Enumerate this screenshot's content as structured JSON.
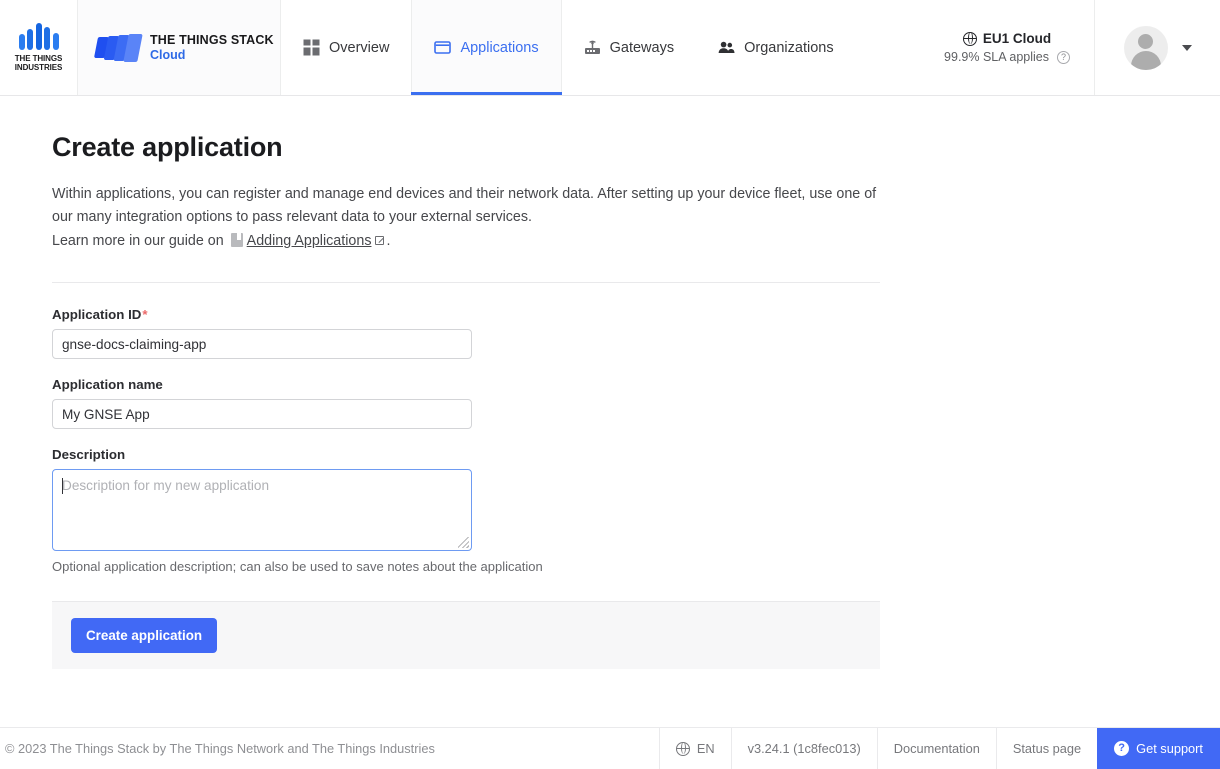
{
  "header": {
    "brand_logo_text": "THE THINGS\nINDUSTRIES",
    "brand_line1": "THE THINGS",
    "brand_line2": "INDUSTRIES",
    "stack_title": "THE THINGS STACK",
    "stack_sub": "Cloud",
    "nav": [
      {
        "label": "Overview",
        "icon": "grid-icon",
        "active": false
      },
      {
        "label": "Applications",
        "icon": "application-icon",
        "active": true
      },
      {
        "label": "Gateways",
        "icon": "gateway-icon",
        "active": false
      },
      {
        "label": "Organizations",
        "icon": "organizations-icon",
        "active": false
      }
    ],
    "cloud": {
      "name": "EU1 Cloud",
      "sla": "99.9% SLA applies",
      "help_glyph": "?",
      "globe_icon": "globe-icon"
    },
    "avatar_icon": "user-avatar",
    "caret_icon": "chevron-down-icon"
  },
  "main": {
    "title": "Create application",
    "intro": "Within applications, you can register and manage end devices and their network data. After setting up your device fleet, use one of our many integration options to pass relevant data to your external services.",
    "guide_prefix": "Learn more in our guide on",
    "guide_link": "Adding Applications",
    "guide_suffix": ".",
    "book_icon": "book-icon",
    "external_icon": "external-link-icon",
    "form": {
      "application_id": {
        "label": "Application ID",
        "required_mark": "*",
        "value": "gnse-docs-claiming-app"
      },
      "application_name": {
        "label": "Application name",
        "value": "My GNSE App"
      },
      "description": {
        "label": "Description",
        "placeholder": "Description for my new application",
        "value": "",
        "hint": "Optional application description; can also be used to save notes about the application"
      },
      "submit_label": "Create application"
    }
  },
  "footer": {
    "copyright": "© 2023 The Things Stack by The Things Network and The Things Industries",
    "language": "EN",
    "version": "v3.24.1 (1c8fec013)",
    "documentation": "Documentation",
    "status_page": "Status page",
    "support": "Get support",
    "support_icon": "help-circle-icon",
    "globe_icon": "globe-icon"
  },
  "colors": {
    "accent_blue": "#4169f5",
    "nav_active": "#3b6ff0",
    "required_red": "#ec6a6a",
    "focus_border": "#6e9bf2"
  }
}
